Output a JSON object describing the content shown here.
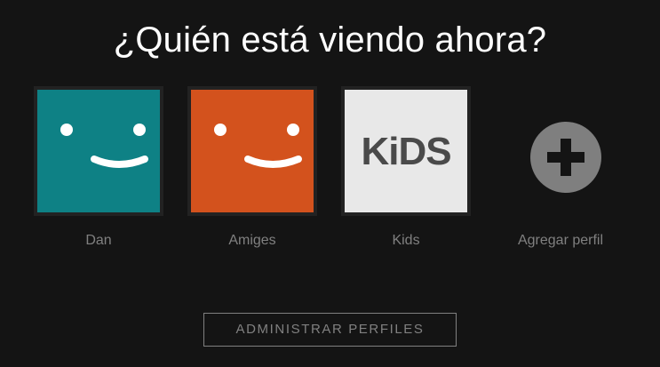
{
  "title": "¿Quién está viendo ahora?",
  "profiles": [
    {
      "label": "Dan",
      "color": "#0e8185",
      "icon": "smiley-face-icon"
    },
    {
      "label": "Amiges",
      "color": "#d3521d",
      "icon": "smiley-face-icon"
    },
    {
      "label": "Kids",
      "color": "#e8e8e8",
      "icon": "kids-logo",
      "logo_text": "KiDS"
    },
    {
      "label": "Agregar perfil",
      "color": "#7f7f7f",
      "icon": "plus-circle-icon"
    }
  ],
  "manage_button": "ADMINISTRAR PERFILES"
}
